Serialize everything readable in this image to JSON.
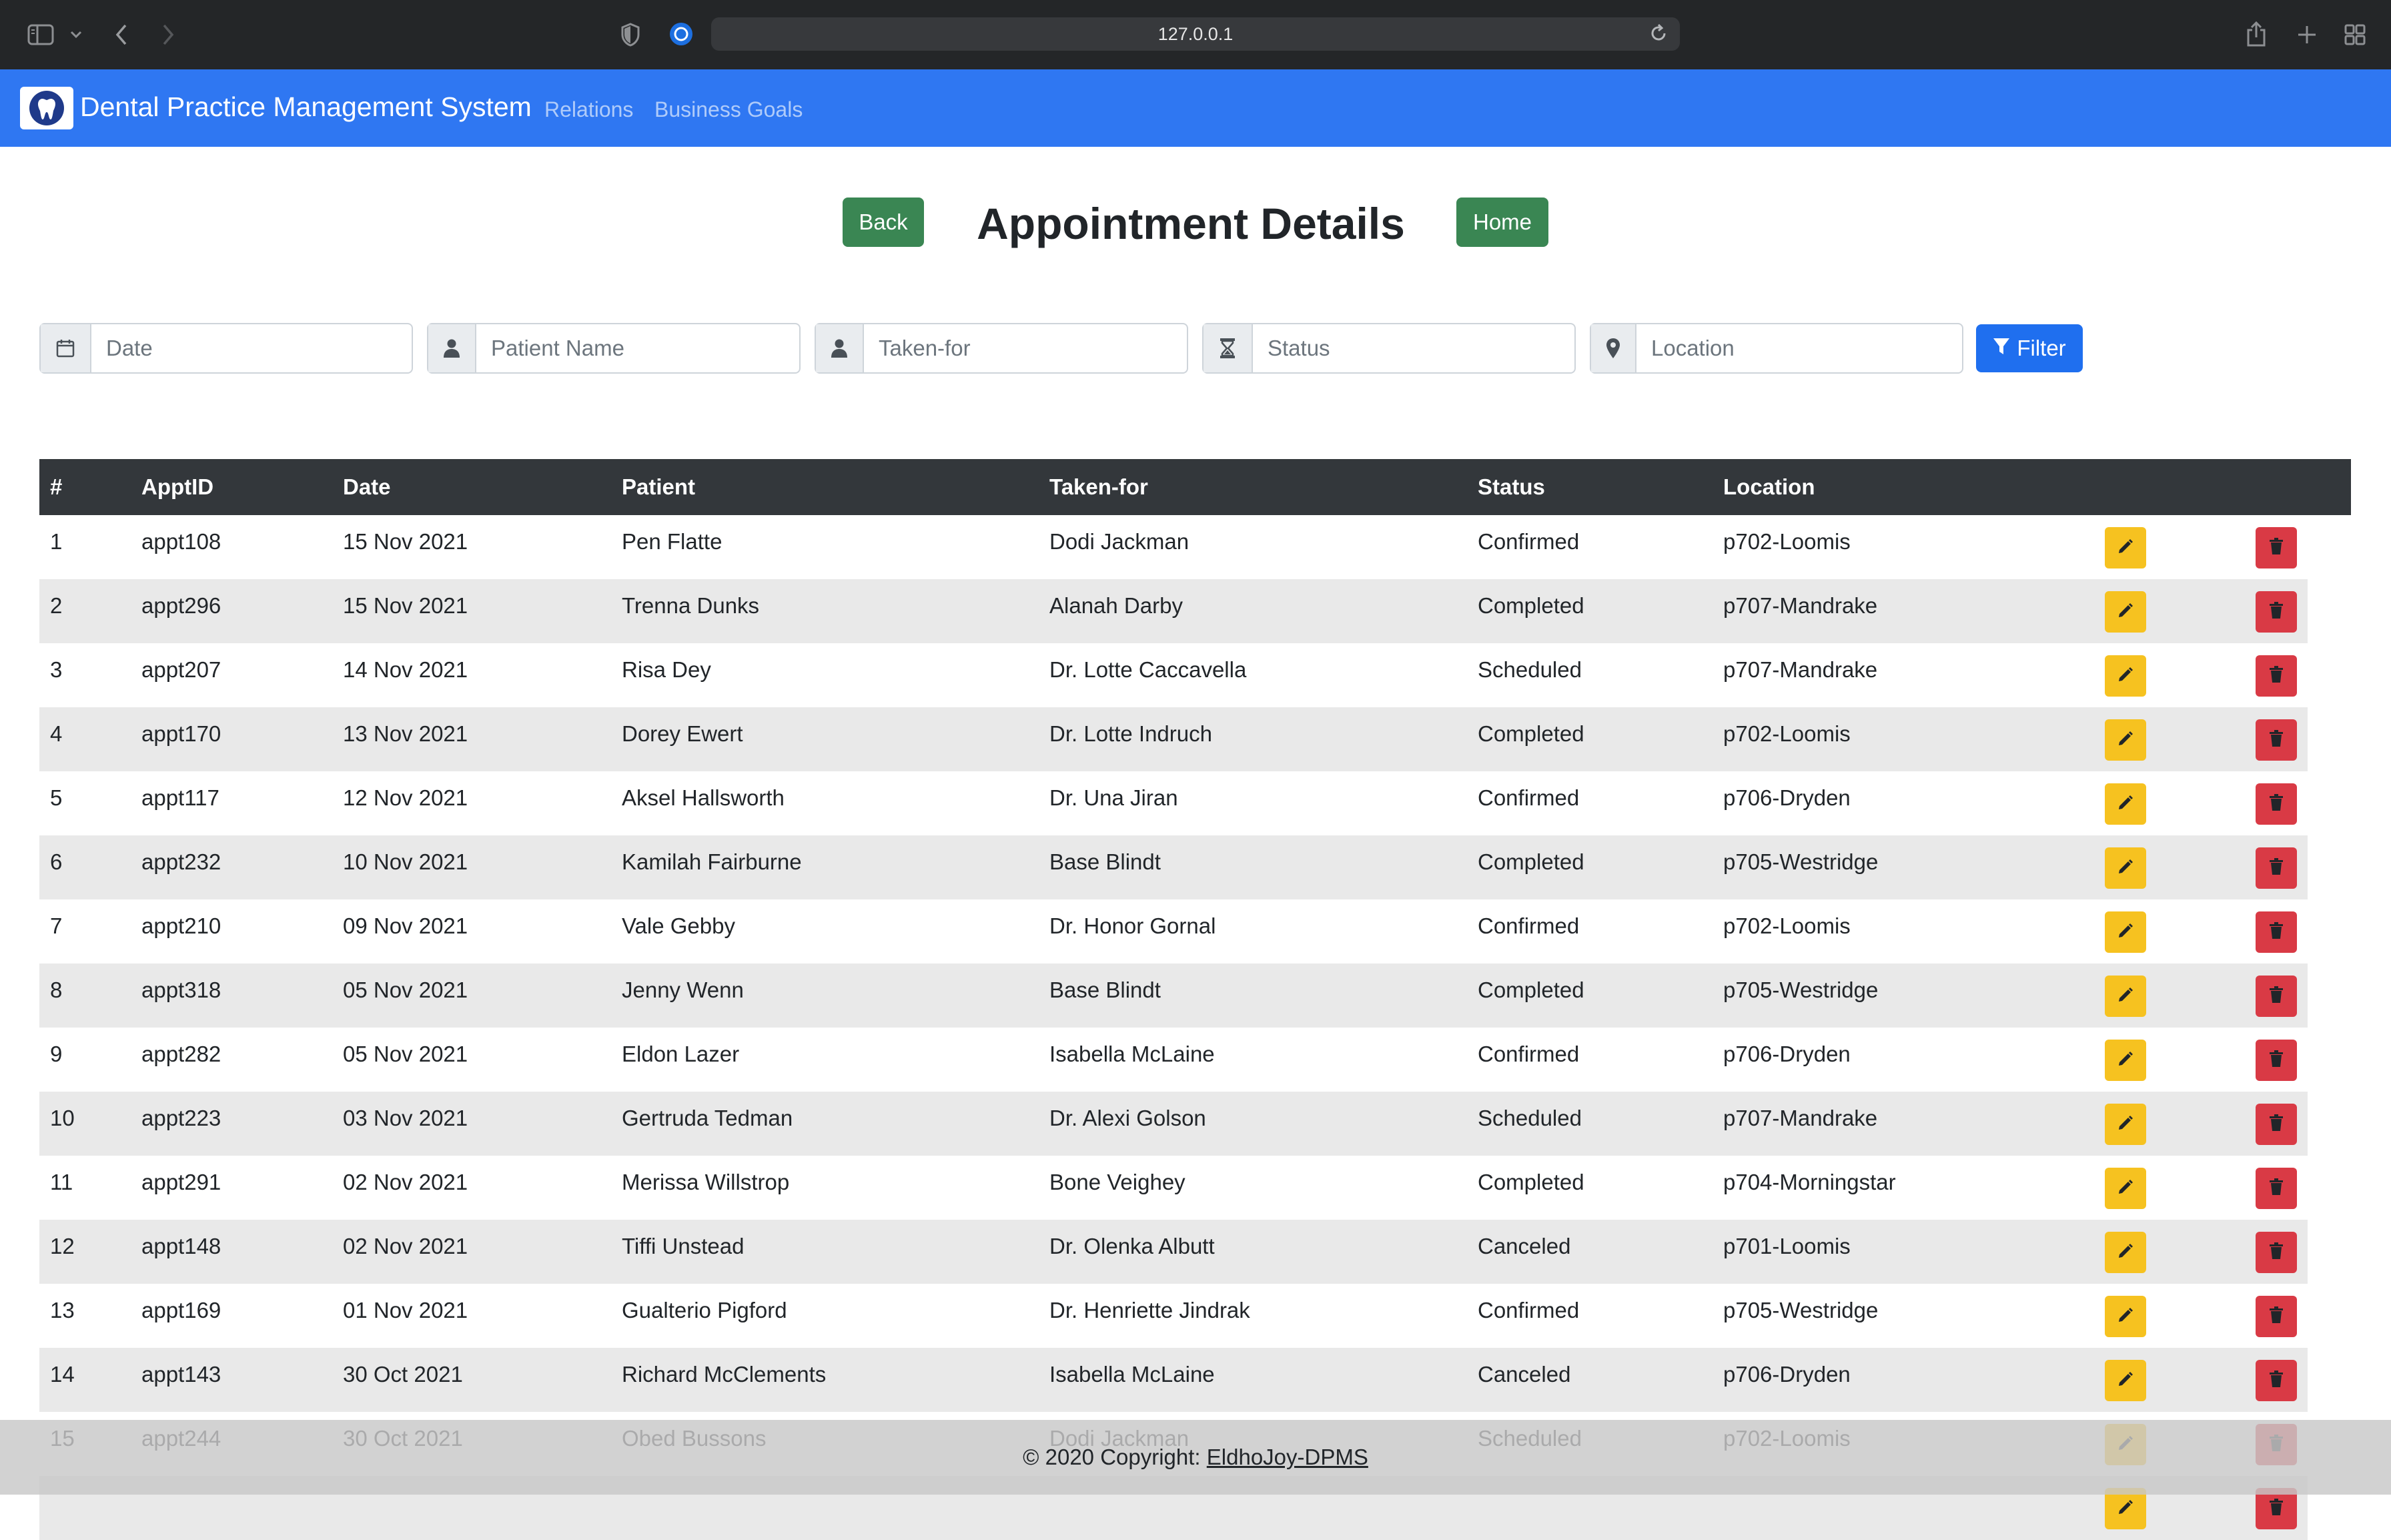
{
  "browser": {
    "url": "127.0.0.1"
  },
  "navbar": {
    "brand": "Dental Practice Management System",
    "links": [
      "Relations",
      "Business Goals"
    ],
    "accent_color": "#2f77f2"
  },
  "header": {
    "title": "Appointment Details",
    "back_label": "Back",
    "home_label": "Home"
  },
  "filters": {
    "date_placeholder": "Date",
    "patient_placeholder": "Patient Name",
    "takenfor_placeholder": "Taken-for",
    "status_placeholder": "Status",
    "location_placeholder": "Location",
    "filter_label": "Filter",
    "icons": [
      "calendar-icon",
      "user-icon",
      "user-icon",
      "hourglass-icon",
      "map-marker-icon"
    ]
  },
  "table": {
    "columns": [
      "#",
      "ApptID",
      "Date",
      "Patient",
      "Taken-for",
      "Status",
      "Location"
    ],
    "rows": [
      {
        "num": "1",
        "id": "appt108",
        "date": "15 Nov 2021",
        "patient": "Pen Flatte",
        "takenfor": "Dodi Jackman",
        "status": "Confirmed",
        "location": "p702-Loomis"
      },
      {
        "num": "2",
        "id": "appt296",
        "date": "15 Nov 2021",
        "patient": "Trenna Dunks",
        "takenfor": "Alanah Darby",
        "status": "Completed",
        "location": "p707-Mandrake"
      },
      {
        "num": "3",
        "id": "appt207",
        "date": "14 Nov 2021",
        "patient": "Risa Dey",
        "takenfor": "Dr. Lotte Caccavella",
        "status": "Scheduled",
        "location": "p707-Mandrake"
      },
      {
        "num": "4",
        "id": "appt170",
        "date": "13 Nov 2021",
        "patient": "Dorey Ewert",
        "takenfor": "Dr. Lotte Indruch",
        "status": "Completed",
        "location": "p702-Loomis"
      },
      {
        "num": "5",
        "id": "appt117",
        "date": "12 Nov 2021",
        "patient": "Aksel Hallsworth",
        "takenfor": "Dr. Una Jiran",
        "status": "Confirmed",
        "location": "p706-Dryden"
      },
      {
        "num": "6",
        "id": "appt232",
        "date": "10 Nov 2021",
        "patient": "Kamilah Fairburne",
        "takenfor": "Base Blindt",
        "status": "Completed",
        "location": "p705-Westridge"
      },
      {
        "num": "7",
        "id": "appt210",
        "date": "09 Nov 2021",
        "patient": "Vale Gebby",
        "takenfor": "Dr. Honor Gornal",
        "status": "Confirmed",
        "location": "p702-Loomis"
      },
      {
        "num": "8",
        "id": "appt318",
        "date": "05 Nov 2021",
        "patient": "Jenny Wenn",
        "takenfor": "Base Blindt",
        "status": "Completed",
        "location": "p705-Westridge"
      },
      {
        "num": "9",
        "id": "appt282",
        "date": "05 Nov 2021",
        "patient": "Eldon Lazer",
        "takenfor": "Isabella McLaine",
        "status": "Confirmed",
        "location": "p706-Dryden"
      },
      {
        "num": "10",
        "id": "appt223",
        "date": "03 Nov 2021",
        "patient": "Gertruda Tedman",
        "takenfor": "Dr. Alexi Golson",
        "status": "Scheduled",
        "location": "p707-Mandrake"
      },
      {
        "num": "11",
        "id": "appt291",
        "date": "02 Nov 2021",
        "patient": "Merissa Willstrop",
        "takenfor": "Bone Veighey",
        "status": "Completed",
        "location": "p704-Morningstar"
      },
      {
        "num": "12",
        "id": "appt148",
        "date": "02 Nov 2021",
        "patient": "Tiffi Unstead",
        "takenfor": "Dr. Olenka Albutt",
        "status": "Canceled",
        "location": "p701-Loomis"
      },
      {
        "num": "13",
        "id": "appt169",
        "date": "01 Nov 2021",
        "patient": "Gualterio Pigford",
        "takenfor": "Dr. Henriette Jindrak",
        "status": "Confirmed",
        "location": "p705-Westridge"
      },
      {
        "num": "14",
        "id": "appt143",
        "date": "30 Oct 2021",
        "patient": "Richard McClements",
        "takenfor": "Isabella McLaine",
        "status": "Canceled",
        "location": "p706-Dryden"
      },
      {
        "num": "15",
        "id": "appt244",
        "date": "30 Oct 2021",
        "patient": "Obed Bussons",
        "takenfor": "Dodi Jackman",
        "status": "Scheduled",
        "location": "p702-Loomis"
      },
      {
        "num": "",
        "id": "",
        "date": "",
        "patient": "",
        "takenfor": "",
        "status": "",
        "location": ""
      }
    ]
  },
  "footer": {
    "prefix": "© 2020 Copyright: ",
    "link": "EldhoJoy-DPMS"
  }
}
